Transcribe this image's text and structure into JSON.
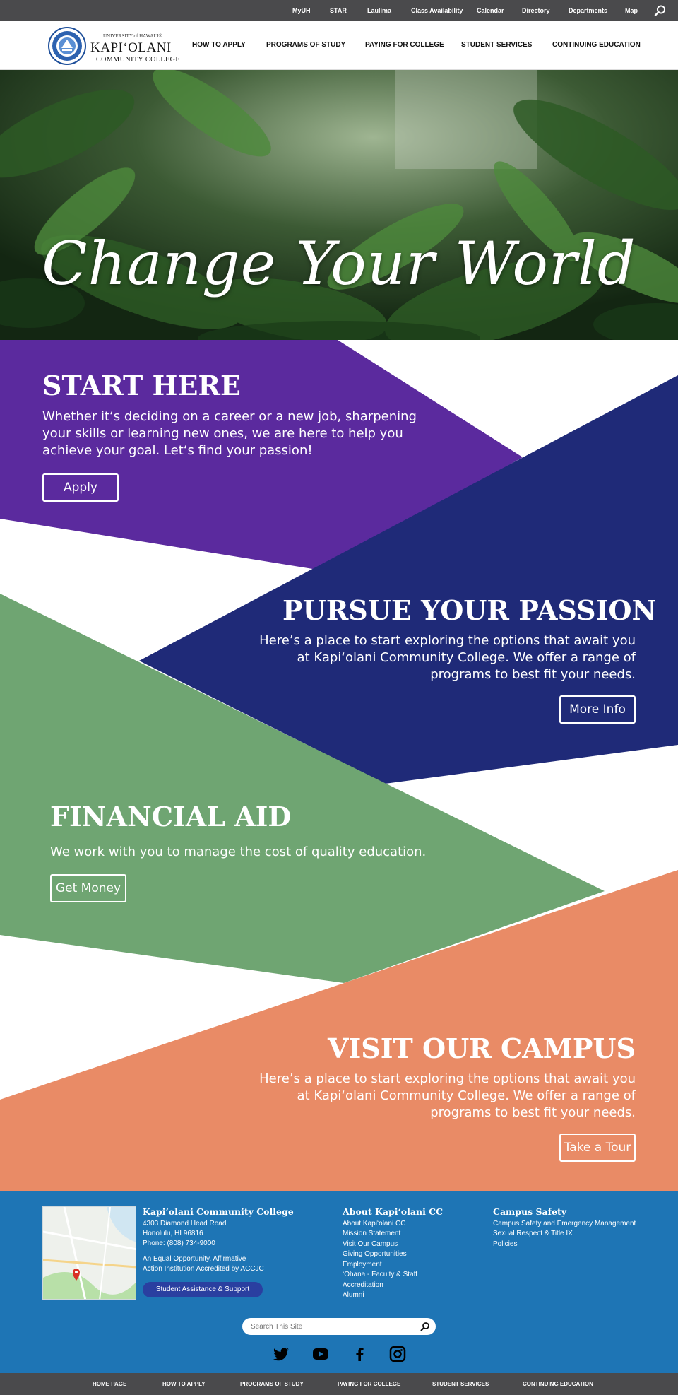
{
  "utility_nav": [
    "MyUH",
    "STAR",
    "Laulima",
    "Class Availability",
    "Calendar",
    "Directory",
    "Departments",
    "Map"
  ],
  "logo": {
    "university": "UNIVERSITY of HAWAIʻI®",
    "name": "KAPIʻOLANI",
    "subtitle": "COMMUNITY COLLEGE"
  },
  "main_nav": [
    "HOW TO APPLY",
    "PROGRAMS OF STUDY",
    "PAYING FOR COLLEGE",
    "STUDENT SERVICES",
    "CONTINUING EDUCATION"
  ],
  "hero": {
    "title": "Change Your World"
  },
  "sections": {
    "start": {
      "title": "START HERE",
      "text": "Whether it‘s deciding on a career or a new job, sharpening your skills or learning new ones, we are here to help you achieve your goal. Let‘s find your passion!",
      "button": "Apply",
      "color": "#5b2a9e"
    },
    "passion": {
      "title": "PURSUE YOUR PASSION",
      "text": "Here’s a place to start exploring the options that await you at Kapiʻolani Community College. We offer a range of programs to best fit your needs.",
      "button": "More Info",
      "color": "#1f2a78"
    },
    "aid": {
      "title": "FINANCIAL AID",
      "text": "We work with you to manage the cost of quality education.",
      "button": "Get Money",
      "color": "#6fa572"
    },
    "campus": {
      "title": "VISIT OUR CAMPUS",
      "text": "Here’s a place to start exploring the options that await you at Kapiʻolani Community College. We offer a range of programs to best fit your needs.",
      "button": "Take a Tour",
      "color": "#e98b66"
    }
  },
  "footer": {
    "college": {
      "title": "Kapiʻolani Community College",
      "address1": "4303 Diamond Head Road",
      "address2": "Honolulu, HI 96816",
      "phone": "Phone: (808) 734-9000",
      "equal1": "An Equal Opportunity, Affirmative",
      "equal2": "Action Institution Accredited by ACCJC",
      "button": "Student Assistance & Support"
    },
    "about": {
      "title": "About Kapiʻolani CC",
      "links": [
        "About Kapiʻolani CC",
        "Mission Statement",
        "Visit Our Campus",
        "Giving Opportunities",
        "Employment",
        "ʻOhana - Faculty & Staff",
        "Accreditation",
        "Alumni"
      ]
    },
    "safety": {
      "title": "Campus Safety",
      "links": [
        "Campus Safety and Emergency Management",
        "Sexual Respect & Title IX",
        "Policies"
      ]
    },
    "search_placeholder": "Search This Site",
    "social": [
      "twitter-icon",
      "youtube-icon",
      "facebook-icon",
      "instagram-icon"
    ],
    "bg_color": "#1e75b5"
  },
  "bottom_nav": [
    "HOME PAGE",
    "HOW TO APPLY",
    "PROGRAMS OF STUDY",
    "PAYING FOR COLLEGE",
    "STUDENT SERVICES",
    "CONTINUING EDUCATION"
  ]
}
